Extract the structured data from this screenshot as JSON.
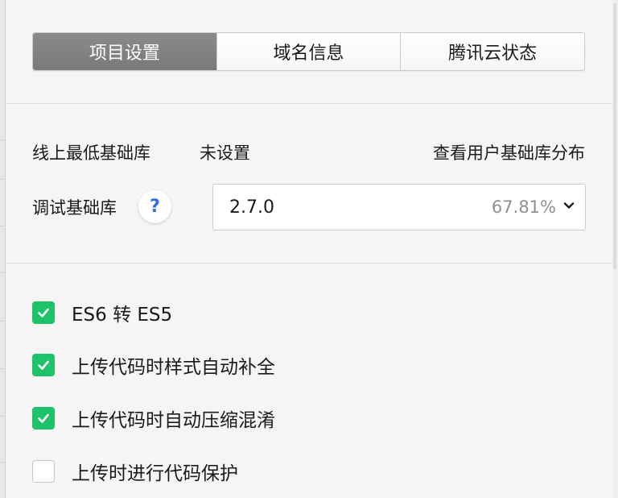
{
  "tabs": [
    {
      "label": "项目设置",
      "active": true
    },
    {
      "label": "域名信息",
      "active": false
    },
    {
      "label": "腾讯云状态",
      "active": false
    }
  ],
  "base_lib": {
    "online_min_label": "线上最低基础库",
    "online_min_value": "未设置",
    "distribution_link": "查看用户基础库分布",
    "debug_label": "调试基础库",
    "help_glyph": "?",
    "selected_version": "2.7.0",
    "selected_percent": "67.81%"
  },
  "options": [
    {
      "label": "ES6 转 ES5",
      "checked": true
    },
    {
      "label": "上传代码时样式自动补全",
      "checked": true
    },
    {
      "label": "上传代码时自动压缩混淆",
      "checked": true
    },
    {
      "label": "上传时进行代码保护",
      "checked": false
    }
  ],
  "colors": {
    "accent": "#1dc26b",
    "active_tab": "#7f7f7f",
    "help_icon": "#2d6bf0"
  }
}
